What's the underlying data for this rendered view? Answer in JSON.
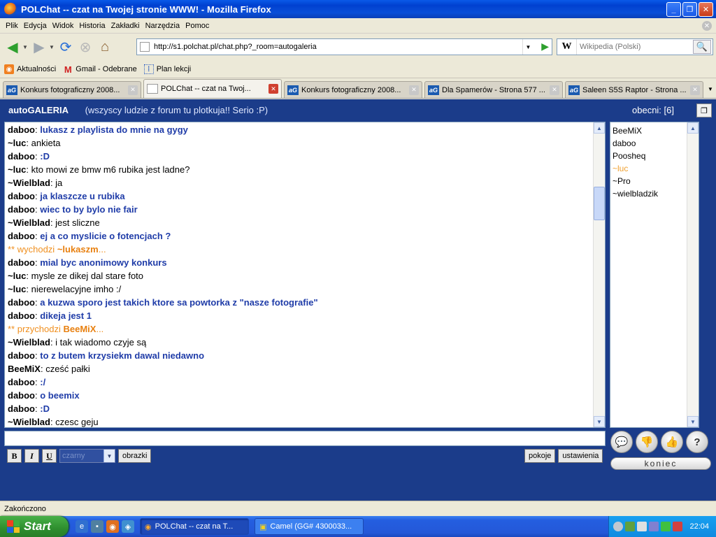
{
  "window": {
    "title": "POLChat -- czat na Twojej stronie WWW! - Mozilla Firefox"
  },
  "menu": [
    "Plik",
    "Edycja",
    "Widok",
    "Historia",
    "Zakładki",
    "Narzędzia",
    "Pomoc"
  ],
  "nav": {
    "url": "http://s1.polchat.pl/chat.php?_room=autogaleria",
    "search_placeholder": "Wikipedia (Polski)",
    "search_engine": "W"
  },
  "bookmarks": [
    "Aktualności",
    "Gmail - Odebrane",
    "Plan lekcji"
  ],
  "tabs": [
    {
      "label": "Konkurs fotograficzny 2008...",
      "fav": "aG",
      "active": false
    },
    {
      "label": "POLChat -- czat na Twoj...",
      "fav": "",
      "active": true
    },
    {
      "label": "Konkurs fotograficzny 2008...",
      "fav": "aG",
      "active": false
    },
    {
      "label": "Dla Spamerów - Strona 577 ...",
      "fav": "aG",
      "active": false
    },
    {
      "label": "Saleen S5S Raptor - Strona ...",
      "fav": "aG",
      "active": false
    }
  ],
  "chat": {
    "room_prefix": "auto",
    "room_name": "GALERIA",
    "topic": "(wszyscy ludzie z forum tu plotkuja!! Serio :P)",
    "present_label": "obecni: [6]",
    "messages": [
      {
        "nick": "daboo",
        "text": "lukasz z playlista do mnie na gygy",
        "style": "blue"
      },
      {
        "nick": "~luc",
        "text": "ankieta",
        "style": "plain"
      },
      {
        "nick": "daboo",
        "text": ":D",
        "style": "blue"
      },
      {
        "nick": "~luc",
        "text": "kto mowi ze bmw m6 rubika jest ladne?",
        "style": "plain"
      },
      {
        "nick": "~Wielblad",
        "text": "ja",
        "style": "plain"
      },
      {
        "nick": "daboo",
        "text": "ja klaszcze u rubika",
        "style": "blue"
      },
      {
        "nick": "daboo",
        "text": "wiec to by bylo nie fair",
        "style": "blue"
      },
      {
        "nick": "~Wielblad",
        "text": "jest sliczne",
        "style": "plain"
      },
      {
        "nick": "daboo",
        "text": "ej a co myslicie o fotencjach ?",
        "style": "blue"
      },
      {
        "system": true,
        "prefix": "** wychodzi ",
        "nick": "~lukaszm",
        "suffix": "..."
      },
      {
        "nick": "daboo",
        "text": "mial byc anonimowy konkurs",
        "style": "blue"
      },
      {
        "nick": "~luc",
        "text": "mysle ze dikej dal stare foto",
        "style": "plain"
      },
      {
        "nick": "~luc",
        "text": "nierewelacyjne imho :/",
        "style": "plain"
      },
      {
        "nick": "daboo",
        "text": "a kuzwa sporo jest takich ktore sa powtorka z \"nasze fotografie\"",
        "style": "blue"
      },
      {
        "nick": "daboo",
        "text": "dikeja jest 1",
        "style": "blue"
      },
      {
        "system": true,
        "prefix": "** przychodzi ",
        "nick": "BeeMiX",
        "suffix": "..."
      },
      {
        "nick": "~Wielblad",
        "text": "i tak wiadomo czyje są",
        "style": "plain"
      },
      {
        "nick": "daboo",
        "text": "to z butem krzysiekm dawal niedawno",
        "style": "blue"
      },
      {
        "nick": "BeeMiX",
        "text": "cześć pałki",
        "style": "plain"
      },
      {
        "nick": "daboo",
        "text": ":/",
        "style": "blue"
      },
      {
        "nick": "daboo",
        "text": "o beemix",
        "style": "blue"
      },
      {
        "nick": "daboo",
        "text": ":D",
        "style": "blue"
      },
      {
        "nick": "~Wielblad",
        "text": "czesc geju",
        "style": "plain"
      }
    ],
    "users": [
      {
        "name": "BeeMiX",
        "highlight": false
      },
      {
        "name": "daboo",
        "highlight": false
      },
      {
        "name": "Poosheq",
        "highlight": false
      },
      {
        "name": "~luc",
        "highlight": true
      },
      {
        "name": "~Pro",
        "highlight": false
      },
      {
        "name": "~wielbladzik",
        "highlight": false
      }
    ],
    "format": {
      "bold": "B",
      "italic": "I",
      "underline": "U",
      "color_select": "czarny",
      "images_button": "obrazki"
    },
    "buttons": {
      "rooms": "pokoje",
      "settings": "ustawienia",
      "koniec": "koniec"
    }
  },
  "status": {
    "text": "Zakończono"
  },
  "taskbar": {
    "start": "Start",
    "items": [
      {
        "label": "POLChat -- czat na T...",
        "active": true
      },
      {
        "label": "Camel (GG# 4300033...",
        "active": false
      }
    ],
    "clock": "22:04"
  },
  "colors": {
    "chat_bg": "#1b3c8a",
    "blue_text": "#1f3ca8",
    "system_text": "#f09020"
  }
}
